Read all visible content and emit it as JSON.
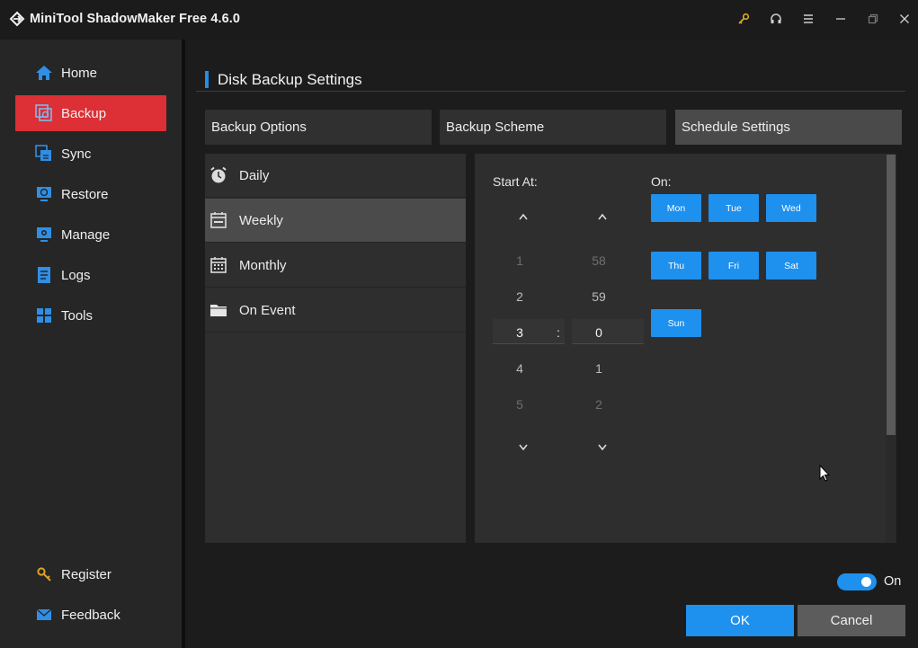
{
  "window": {
    "title": "MiniTool ShadowMaker Free 4.6.0",
    "controls": [
      "key-icon",
      "headset-icon",
      "menu-icon",
      "minimize-icon",
      "restore-icon",
      "close-icon"
    ]
  },
  "sidebar": {
    "items": [
      {
        "label": "Home",
        "icon": "home-icon"
      },
      {
        "label": "Backup",
        "icon": "backup-icon",
        "active": true
      },
      {
        "label": "Sync",
        "icon": "sync-icon"
      },
      {
        "label": "Restore",
        "icon": "restore-icon"
      },
      {
        "label": "Manage",
        "icon": "manage-icon"
      },
      {
        "label": "Logs",
        "icon": "logs-icon"
      },
      {
        "label": "Tools",
        "icon": "tools-icon"
      }
    ],
    "bottom": [
      {
        "label": "Register",
        "icon": "key-icon"
      },
      {
        "label": "Feedback",
        "icon": "mail-icon"
      }
    ]
  },
  "page": {
    "title": "Disk Backup Settings",
    "tabs": [
      {
        "label": "Backup Options"
      },
      {
        "label": "Backup Scheme"
      },
      {
        "label": "Schedule Settings",
        "active": true
      }
    ]
  },
  "schedule": {
    "frequencies": [
      {
        "label": "Daily",
        "icon": "alarm-clock-icon"
      },
      {
        "label": "Weekly",
        "icon": "calendar-week-icon",
        "active": true
      },
      {
        "label": "Monthly",
        "icon": "calendar-month-icon"
      },
      {
        "label": "On Event",
        "icon": "folder-icon"
      }
    ],
    "start_label": "Start At:",
    "on_label": "On:",
    "hour": {
      "values": [
        "1",
        "2",
        "3",
        "4",
        "5"
      ],
      "selected": "3"
    },
    "minute": {
      "values": [
        "58",
        "59",
        "0",
        "1",
        "2"
      ],
      "selected": "0"
    },
    "separator": ":",
    "days": [
      {
        "label": "Mon",
        "selected": true
      },
      {
        "label": "Tue",
        "selected": true
      },
      {
        "label": "Wed",
        "selected": true
      },
      {
        "label": "Thu",
        "selected": true
      },
      {
        "label": "Fri",
        "selected": true
      },
      {
        "label": "Sat",
        "selected": true
      },
      {
        "label": "Sun",
        "selected": true
      }
    ]
  },
  "footer": {
    "toggle_label": "On",
    "toggle_on": true,
    "ok_label": "OK",
    "cancel_label": "Cancel"
  },
  "colors": {
    "accent": "#1e90ee",
    "active_nav": "#dc2f36",
    "background": "#1c1c1c"
  }
}
